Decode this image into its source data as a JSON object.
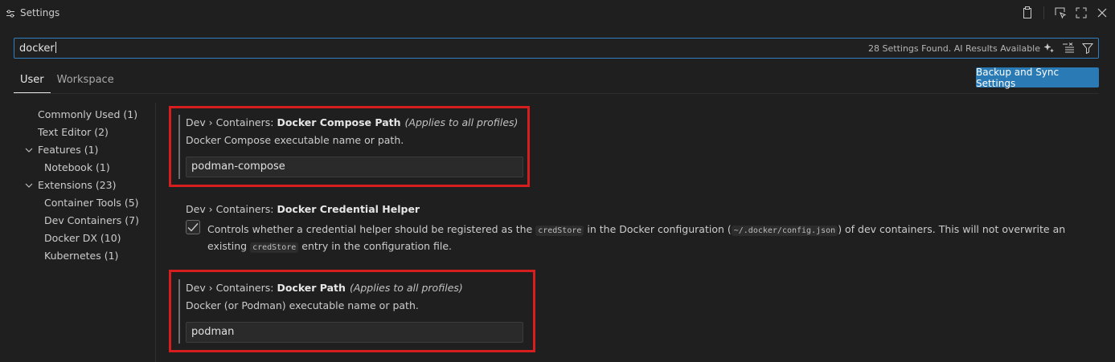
{
  "window": {
    "title": "Settings",
    "actions": [
      "open-json-icon",
      "inspect-icon",
      "maximize-icon",
      "close-icon"
    ]
  },
  "search": {
    "value": "docker",
    "result_count": "28 Settings Found. AI Results Available",
    "icons": [
      "ai-sparkle-icon",
      "clear-filter-icon",
      "filter-icon"
    ]
  },
  "tabs": [
    {
      "label": "User",
      "active": true
    },
    {
      "label": "Workspace",
      "active": false
    }
  ],
  "sync_button": "Backup and Sync Settings",
  "toc": [
    {
      "label": "Commonly Used (1)",
      "level": 0,
      "expandable": false
    },
    {
      "label": "Text Editor (2)",
      "level": 0,
      "expandable": false
    },
    {
      "label": "Features (1)",
      "level": 0,
      "expandable": true
    },
    {
      "label": "Notebook (1)",
      "level": 1,
      "expandable": false
    },
    {
      "label": "Extensions (23)",
      "level": 0,
      "expandable": true
    },
    {
      "label": "Container Tools (5)",
      "level": 1,
      "expandable": false
    },
    {
      "label": "Dev Containers (7)",
      "level": 1,
      "expandable": false
    },
    {
      "label": "Docker DX (10)",
      "level": 1,
      "expandable": false
    },
    {
      "label": "Kubernetes (1)",
      "level": 1,
      "expandable": false
    }
  ],
  "settings": {
    "compose_path": {
      "category": "Dev › Containers: ",
      "name": "Docker Compose Path",
      "scope": "(Applies to all profiles)",
      "description": "Docker Compose executable name or path.",
      "value": "podman-compose"
    },
    "credential_helper": {
      "category": "Dev › Containers: ",
      "name": "Docker Credential Helper",
      "checked": true,
      "desc_part1": "Controls whether a credential helper should be registered as the",
      "code1": "credStore",
      "desc_part2": "in the Docker configuration (",
      "code2": "~/.docker/config.json",
      "desc_part3": ") of dev containers. This will not overwrite an existing",
      "code3": "credStore",
      "desc_part4": "entry in the configuration file."
    },
    "docker_path": {
      "category": "Dev › Containers: ",
      "name": "Docker Path",
      "scope": "(Applies to all profiles)",
      "description": "Docker (or Podman) executable name or path.",
      "value": "podman"
    }
  },
  "colors": {
    "background": "#1f1f1f",
    "accent": "#2a7ab6",
    "highlight_box": "#d71e1e"
  }
}
